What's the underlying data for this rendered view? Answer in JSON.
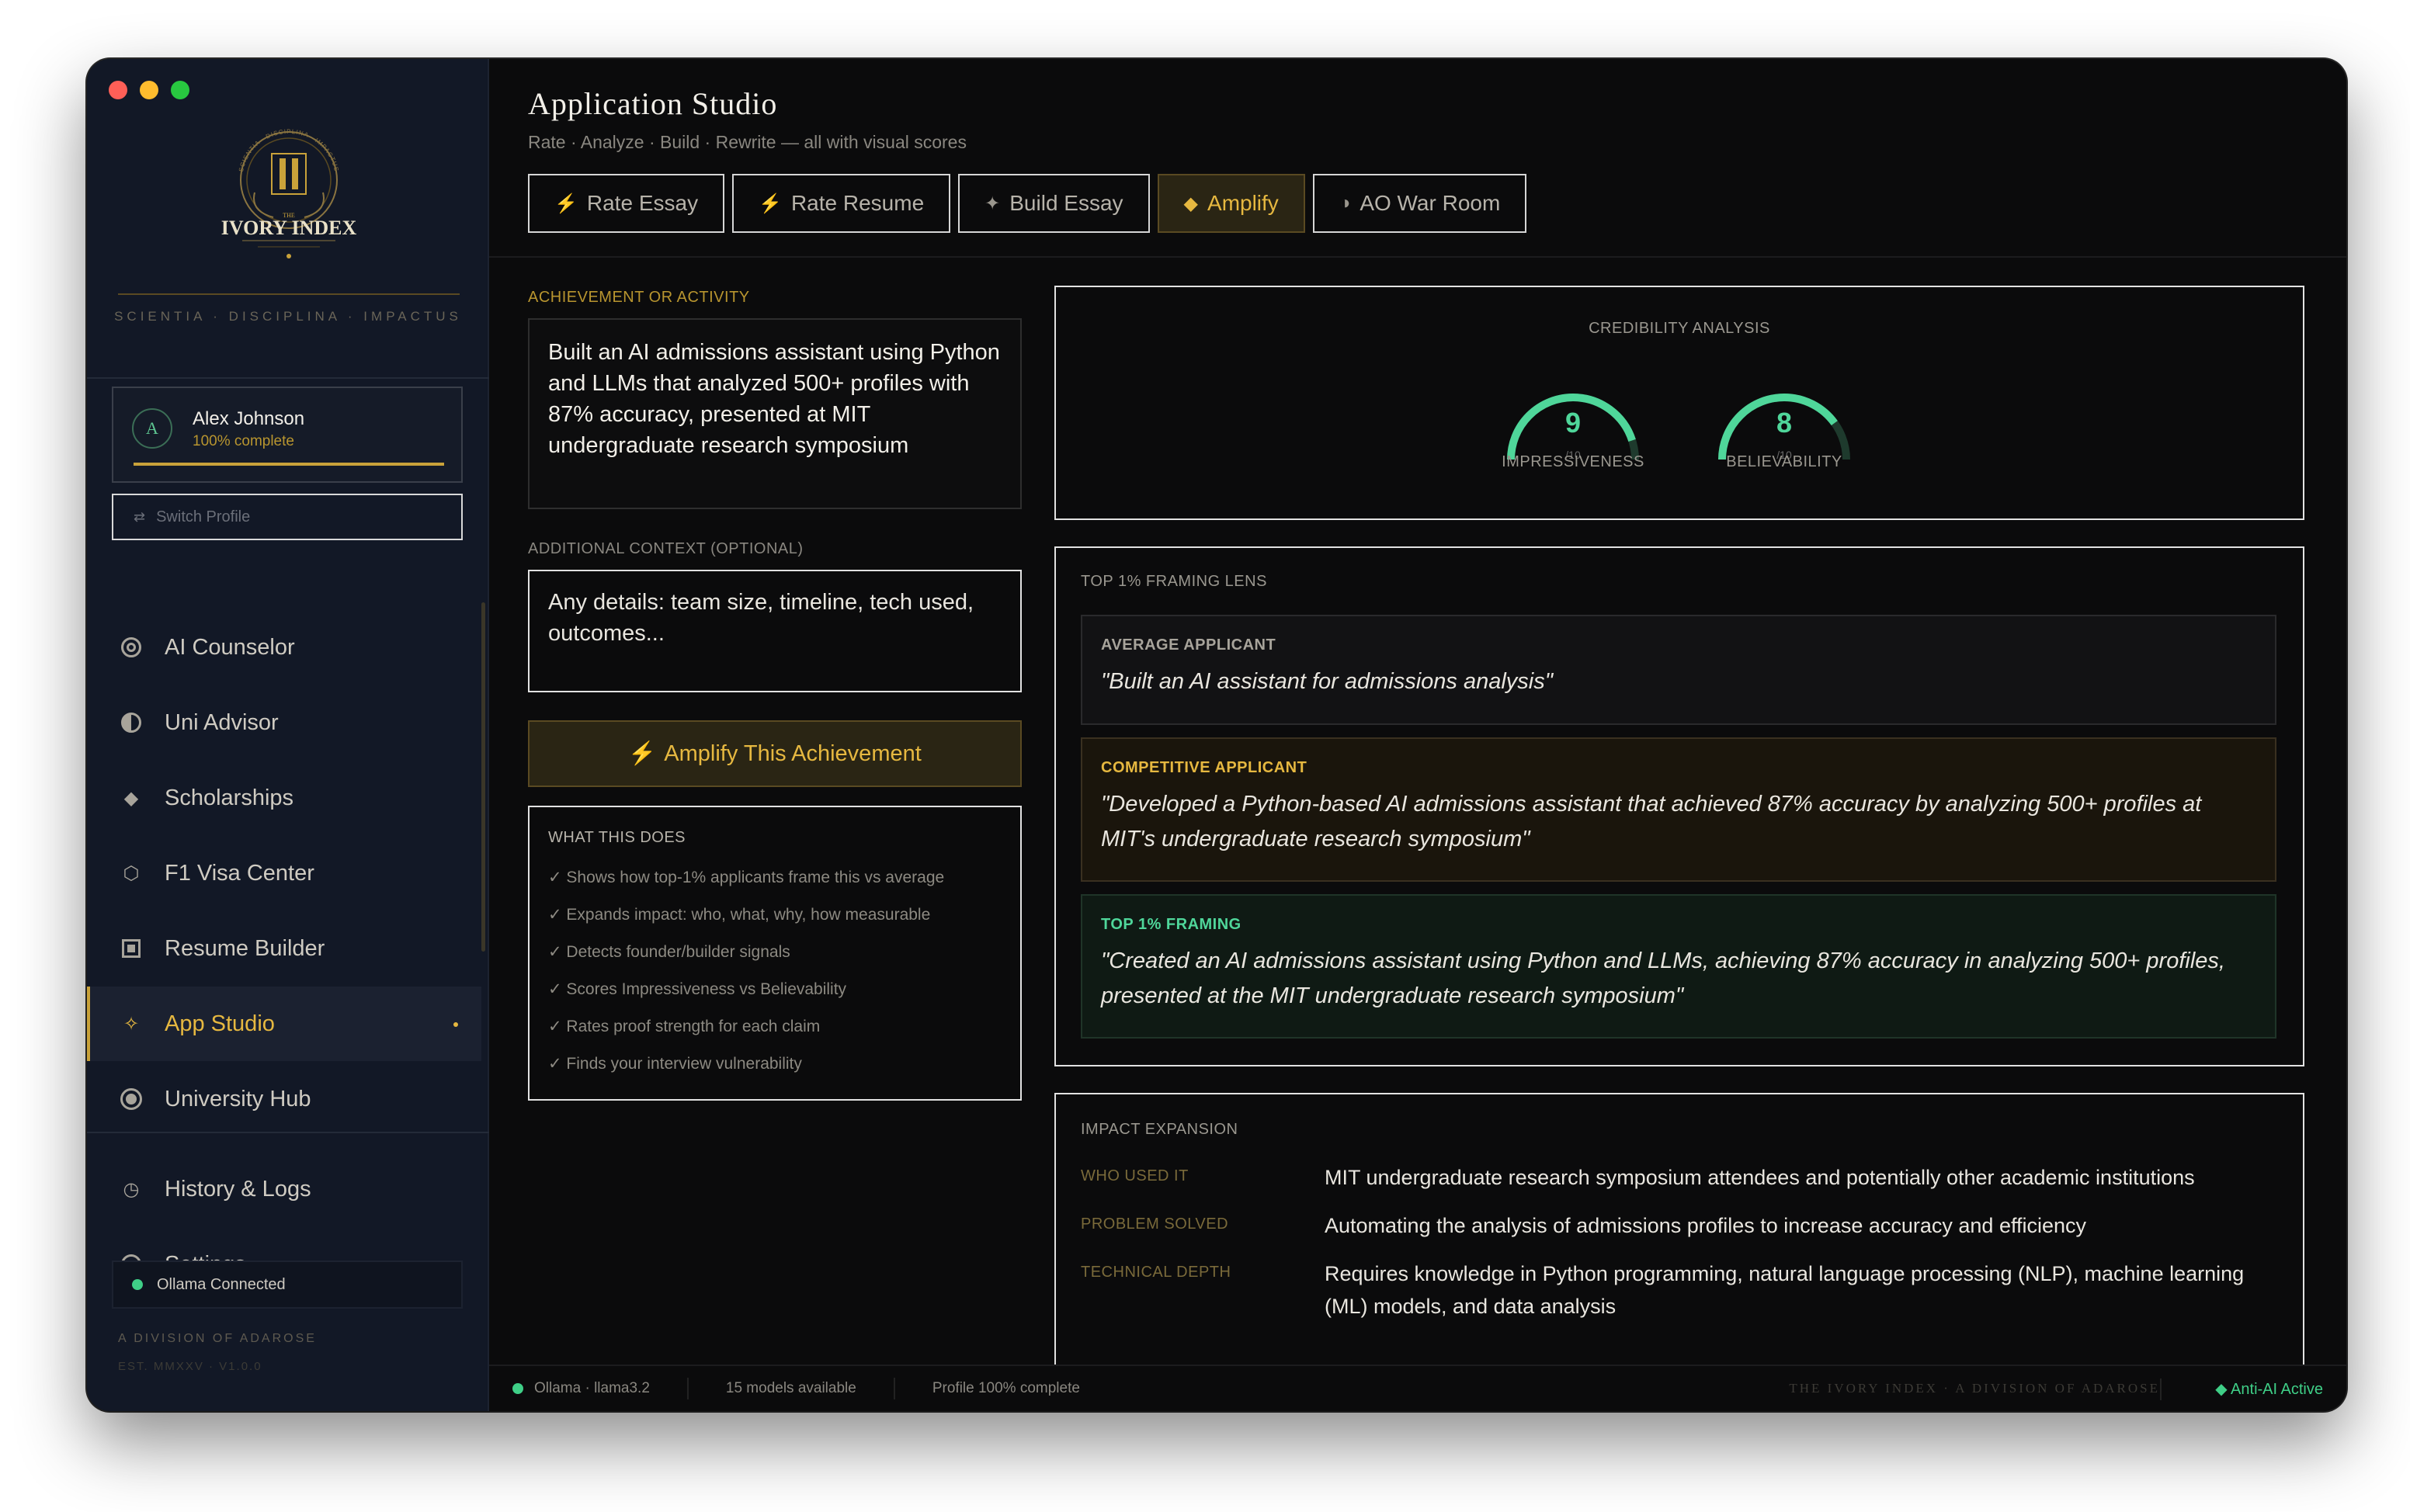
{
  "window": {
    "traffic": [
      "#ff5f57",
      "#febc2e",
      "#28c840"
    ]
  },
  "sidebar": {
    "logo_top": "SCIENTIA · DISCIPLINA · IMPACTUS",
    "logo_name": "IVORY INDEX",
    "logo_the": "THE",
    "motto": "SCIENTIA · DISCIPLINA · IMPACTUS",
    "profile": {
      "initial": "A",
      "name": "Alex Johnson",
      "progress": "100% complete",
      "progress_fraction": 1.0
    },
    "switch_profile": "Switch Profile",
    "nav": [
      {
        "label": "AI Counselor",
        "icon": "target-icon"
      },
      {
        "label": "Uni Advisor",
        "icon": "half-circle-icon"
      },
      {
        "label": "Scholarships",
        "icon": "diamond-icon"
      },
      {
        "label": "F1 Visa Center",
        "icon": "hexagon-icon"
      },
      {
        "label": "Resume Builder",
        "icon": "square-icon"
      },
      {
        "label": "App Studio",
        "icon": "sparkle-icon",
        "active": true
      },
      {
        "label": "University Hub",
        "icon": "filled-circle-icon"
      },
      {
        "label": "History & Logs",
        "icon": "clock-icon"
      },
      {
        "label": "Settings",
        "icon": "circle-icon"
      }
    ],
    "ollama": "Ollama Connected",
    "division": "A DIVISION OF ADAROSE",
    "est": "EST. MMXXV · V1.0.0"
  },
  "header": {
    "title": "Application Studio",
    "subtitle": "Rate · Analyze · Build · Rewrite — all with visual scores",
    "tabs": [
      {
        "label": "Rate Essay",
        "icon": "⚡"
      },
      {
        "label": "Rate Resume",
        "icon": "⚡"
      },
      {
        "label": "Build Essay",
        "icon": "✦"
      },
      {
        "label": "Amplify",
        "icon": "◆",
        "active": true
      },
      {
        "label": "AO War Room",
        "icon": "◑"
      }
    ]
  },
  "form": {
    "achievement_label": "ACHIEVEMENT OR ACTIVITY",
    "achievement_text": "Built an AI admissions assistant using Python and LLMs that analyzed 500+ profiles with 87% accuracy, presented at MIT undergraduate research symposium",
    "context_label": "ADDITIONAL CONTEXT (OPTIONAL)",
    "context_placeholder": "Any details: team size, timeline, tech used, outcomes...",
    "amplify_button": "Amplify This Achievement",
    "what_title": "WHAT THIS DOES",
    "what_items": [
      "✓ Shows how top-1% applicants frame this vs average",
      "✓ Expands impact: who, what, why, how measurable",
      "✓ Detects founder/builder signals",
      "✓ Scores Impressiveness vs Believability",
      "✓ Rates proof strength for each claim",
      "✓ Finds your interview vulnerability"
    ]
  },
  "credibility": {
    "title": "CREDIBILITY ANALYSIS",
    "gauges": [
      {
        "value": "9",
        "label": "IMPRESSIVENESS",
        "fraction": 0.9,
        "sub": "/10"
      },
      {
        "value": "8",
        "label": "BELIEVABILITY",
        "fraction": 0.8,
        "sub": "/10"
      }
    ],
    "accent": "#4fd69a"
  },
  "lens": {
    "title": "TOP 1% FRAMING LENS",
    "average": {
      "label": "AVERAGE APPLICANT",
      "quote": "\"Built an AI assistant for admissions analysis\""
    },
    "competitive": {
      "label": "COMPETITIVE APPLICANT",
      "quote": "\"Developed a Python-based AI admissions assistant that achieved 87% accuracy by analyzing 500+ profiles at MIT's undergraduate research symposium\""
    },
    "top": {
      "label": "TOP 1% FRAMING",
      "quote": "\"Created an AI admissions assistant using Python and LLMs, achieving 87% accuracy in analyzing 500+ profiles, presented at the MIT undergraduate research symposium\""
    }
  },
  "impact": {
    "title": "IMPACT EXPANSION",
    "rows": [
      {
        "key": "WHO USED IT",
        "value": "MIT undergraduate research symposium attendees and potentially other academic institutions"
      },
      {
        "key": "PROBLEM SOLVED",
        "value": "Automating the analysis of admissions profiles to increase accuracy and efficiency"
      },
      {
        "key": "TECHNICAL DEPTH",
        "value": "Requires knowledge in Python programming, natural language processing (NLP), machine learning (ML) models, and data analysis"
      }
    ]
  },
  "status": {
    "model": "Ollama · llama3.2",
    "models": "15 models available",
    "profile": "Profile 100% complete",
    "brand": "THE IVORY INDEX · A DIVISION OF ADAROSE",
    "anti": "◆ Anti-AI Active"
  }
}
